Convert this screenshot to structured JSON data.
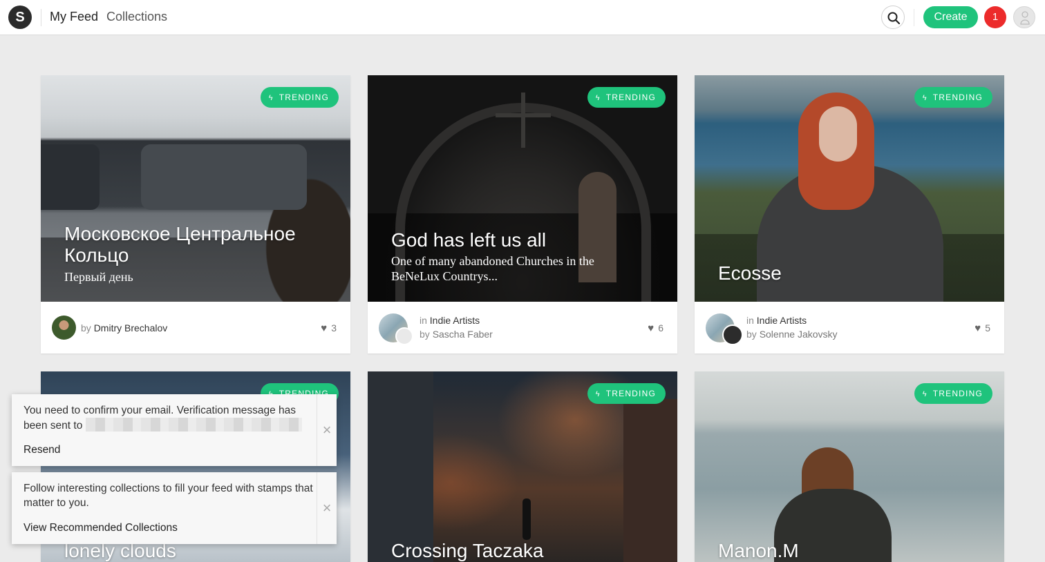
{
  "header": {
    "logo_letter": "S",
    "nav_feed": "My Feed",
    "nav_collections": "Collections",
    "create_label": "Create",
    "notification_count": "1"
  },
  "cards": [
    {
      "badge": "TRENDING",
      "title": "Московское Центральное Кольцо",
      "subtitle": "Первый день",
      "author_prefix": "by",
      "author": "Dmitry Brechalov",
      "likes": "3"
    },
    {
      "badge": "TRENDING",
      "title": "God has left us all",
      "subtitle": "One of many abandoned Churches in the BeNeLux Countrys...",
      "collection_prefix": "in",
      "collection": "Indie Artists",
      "author_prefix": "by",
      "author": "Sascha Faber",
      "likes": "6"
    },
    {
      "badge": "TRENDING",
      "title": "Ecosse",
      "collection_prefix": "in",
      "collection": "Indie Artists",
      "author_prefix": "by",
      "author": "Solenne Jakovsky",
      "likes": "5"
    },
    {
      "badge": "TRENDING",
      "title": "lonely clouds"
    },
    {
      "badge": "TRENDING",
      "title": "Crossing Taczaka"
    },
    {
      "badge": "TRENDING",
      "title": "Manon.M"
    }
  ],
  "toasts": [
    {
      "message": "You need to confirm your email. Verification message has been sent to",
      "action": "Resend"
    },
    {
      "message": "Follow interesting collections to fill your feed with stamps that matter to you.",
      "action": "View Recommended Collections"
    }
  ],
  "colors": {
    "accent": "#1fc37c",
    "notification": "#ec2b2b",
    "background": "#ebebeb"
  }
}
